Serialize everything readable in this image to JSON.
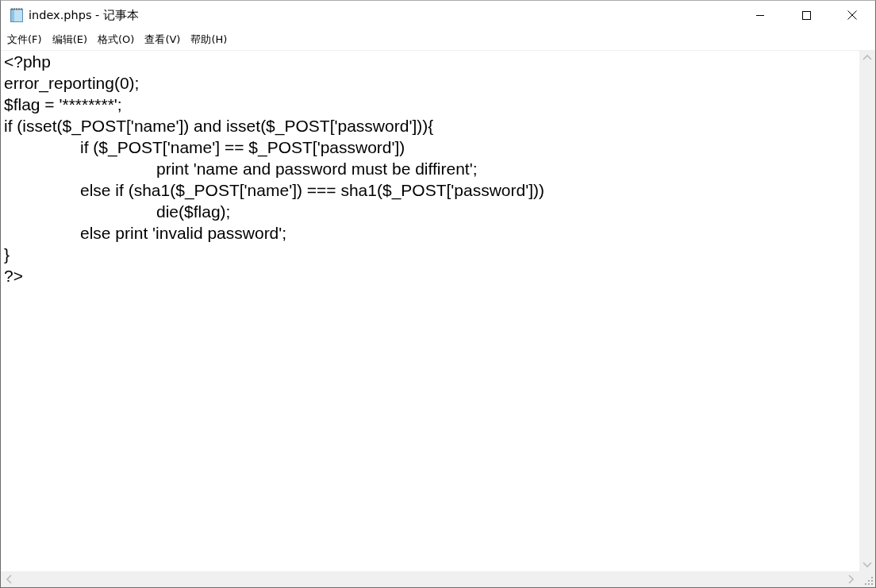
{
  "window": {
    "title": "index.phps - 记事本"
  },
  "menu": [
    "文件(F)",
    "编辑(E)",
    "格式(O)",
    "查看(V)",
    "帮助(H)"
  ],
  "editor": {
    "lines": [
      {
        "text": "<?php"
      },
      {
        "text": "error_reporting(0);"
      },
      {
        "text": "$flag = '********';"
      },
      {
        "text": "if (isset($_POST['name']) and isset($_POST['password'])){",
        "children": [
          {
            "text": "if ($_POST['name'] == $_POST['password'])",
            "children": [
              {
                "text": "print 'name and password must be diffirent';"
              }
            ]
          },
          {
            "text": "else if (sha1($_POST['name']) === sha1($_POST['password']))",
            "children": [
              {
                "text": "die($flag);"
              }
            ]
          },
          {
            "text": "else print 'invalid password';"
          }
        ]
      },
      {
        "text": "}"
      },
      {
        "text": "?>"
      }
    ]
  }
}
